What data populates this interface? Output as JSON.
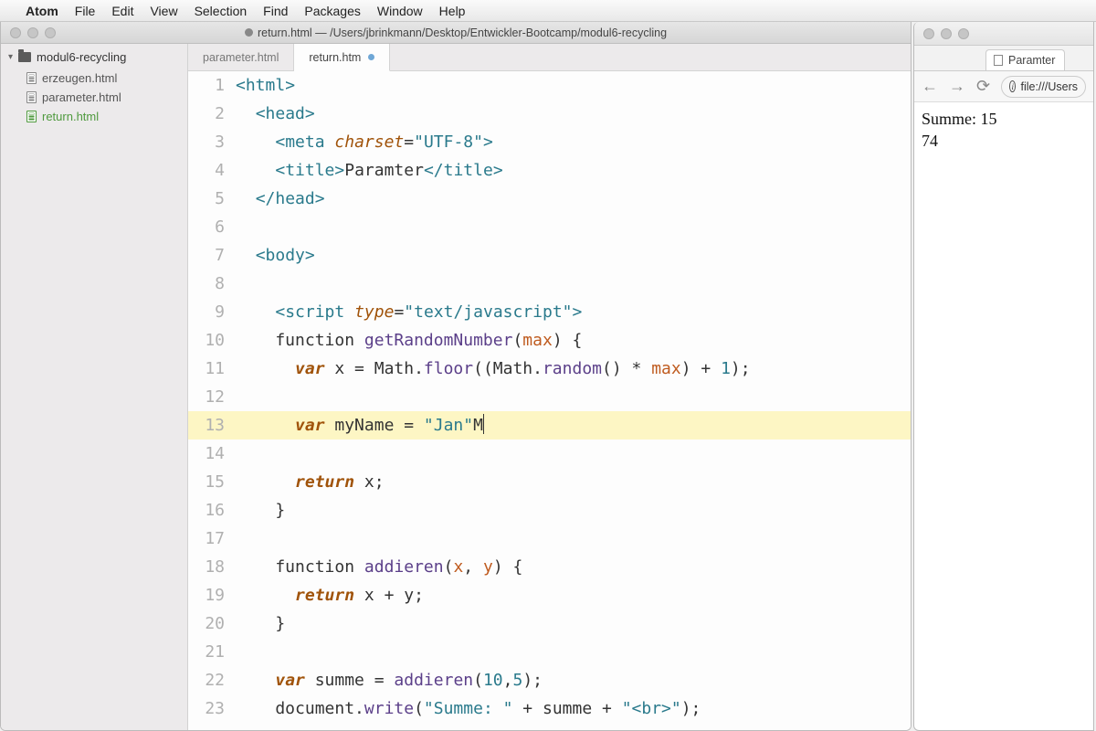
{
  "menubar": {
    "apple": "",
    "items": [
      "Atom",
      "File",
      "Edit",
      "View",
      "Selection",
      "Find",
      "Packages",
      "Window",
      "Help"
    ]
  },
  "window_title": "return.html — /Users/jbrinkmann/Desktop/Entwickler-Bootcamp/modul6-recycling",
  "sidebar": {
    "project": "modul6-recycling",
    "files": [
      {
        "name": "erzeugen.html",
        "active": false
      },
      {
        "name": "parameter.html",
        "active": false
      },
      {
        "name": "return.html",
        "active": true
      }
    ]
  },
  "tabs": [
    {
      "label": "parameter.html",
      "active": false,
      "modified": false
    },
    {
      "label": "return.htm",
      "active": true,
      "modified": true
    }
  ],
  "code_lines": [
    {
      "n": 1,
      "hl": false,
      "seg": [
        {
          "t": "<",
          "c": "p-tag"
        },
        {
          "t": "html",
          "c": "p-tag"
        },
        {
          "t": ">",
          "c": "p-tag"
        }
      ],
      "ind": 0
    },
    {
      "n": 2,
      "hl": false,
      "seg": [
        {
          "t": "<",
          "c": "p-tag"
        },
        {
          "t": "head",
          "c": "p-tag"
        },
        {
          "t": ">",
          "c": "p-tag"
        }
      ],
      "ind": 1
    },
    {
      "n": 3,
      "hl": false,
      "seg": [
        {
          "t": "<",
          "c": "p-tag"
        },
        {
          "t": "meta",
          "c": "p-tag"
        },
        {
          "t": " ",
          "c": ""
        },
        {
          "t": "charset",
          "c": "p-attr"
        },
        {
          "t": "=",
          "c": ""
        },
        {
          "t": "\"UTF-8\"",
          "c": "p-str"
        },
        {
          "t": ">",
          "c": "p-tag"
        }
      ],
      "ind": 2
    },
    {
      "n": 4,
      "hl": false,
      "seg": [
        {
          "t": "<",
          "c": "p-tag"
        },
        {
          "t": "title",
          "c": "p-tag"
        },
        {
          "t": ">",
          "c": "p-tag"
        },
        {
          "t": "Paramter",
          "c": ""
        },
        {
          "t": "</",
          "c": "p-tag"
        },
        {
          "t": "title",
          "c": "p-tag"
        },
        {
          "t": ">",
          "c": "p-tag"
        }
      ],
      "ind": 2
    },
    {
      "n": 5,
      "hl": false,
      "seg": [
        {
          "t": "</",
          "c": "p-tag"
        },
        {
          "t": "head",
          "c": "p-tag"
        },
        {
          "t": ">",
          "c": "p-tag"
        }
      ],
      "ind": 1
    },
    {
      "n": 6,
      "hl": false,
      "seg": [],
      "ind": 0
    },
    {
      "n": 7,
      "hl": false,
      "seg": [
        {
          "t": "<",
          "c": "p-tag"
        },
        {
          "t": "body",
          "c": "p-tag"
        },
        {
          "t": ">",
          "c": "p-tag"
        }
      ],
      "ind": 1
    },
    {
      "n": 8,
      "hl": false,
      "seg": [],
      "ind": 0
    },
    {
      "n": 9,
      "hl": false,
      "seg": [
        {
          "t": "<",
          "c": "p-tag"
        },
        {
          "t": "script",
          "c": "p-tag"
        },
        {
          "t": " ",
          "c": ""
        },
        {
          "t": "type",
          "c": "p-attr"
        },
        {
          "t": "=",
          "c": ""
        },
        {
          "t": "\"text/javascript\"",
          "c": "p-str"
        },
        {
          "t": ">",
          "c": "p-tag"
        }
      ],
      "ind": 2
    },
    {
      "n": 10,
      "hl": false,
      "seg": [
        {
          "t": "function",
          "c": ""
        },
        {
          "t": " ",
          "c": ""
        },
        {
          "t": "getRandomNumber",
          "c": "p-fn"
        },
        {
          "t": "(",
          "c": ""
        },
        {
          "t": "max",
          "c": "p-param"
        },
        {
          "t": ") {",
          "c": ""
        }
      ],
      "ind": 2
    },
    {
      "n": 11,
      "hl": false,
      "seg": [
        {
          "t": "var",
          "c": "p-kw"
        },
        {
          "t": " x = Math.",
          "c": ""
        },
        {
          "t": "floor",
          "c": "p-fn"
        },
        {
          "t": "((Math.",
          "c": ""
        },
        {
          "t": "random",
          "c": "p-fn"
        },
        {
          "t": "() * ",
          "c": ""
        },
        {
          "t": "max",
          "c": "p-param"
        },
        {
          "t": ") + ",
          "c": ""
        },
        {
          "t": "1",
          "c": "p-num"
        },
        {
          "t": ");",
          "c": ""
        }
      ],
      "ind": 3
    },
    {
      "n": 12,
      "hl": false,
      "seg": [],
      "ind": 0
    },
    {
      "n": 13,
      "hl": true,
      "seg": [
        {
          "t": "var",
          "c": "p-kw"
        },
        {
          "t": " myName = ",
          "c": ""
        },
        {
          "t": "\"Jan\"",
          "c": "p-str"
        },
        {
          "t": "M",
          "c": ""
        },
        {
          "t": "",
          "c": "cursor"
        }
      ],
      "ind": 3
    },
    {
      "n": 14,
      "hl": false,
      "seg": [],
      "ind": 0
    },
    {
      "n": 15,
      "hl": false,
      "seg": [
        {
          "t": "return",
          "c": "p-kw"
        },
        {
          "t": " x;",
          "c": ""
        }
      ],
      "ind": 3
    },
    {
      "n": 16,
      "hl": false,
      "seg": [
        {
          "t": "}",
          "c": ""
        }
      ],
      "ind": 2
    },
    {
      "n": 17,
      "hl": false,
      "seg": [],
      "ind": 0
    },
    {
      "n": 18,
      "hl": false,
      "seg": [
        {
          "t": "function",
          "c": ""
        },
        {
          "t": " ",
          "c": ""
        },
        {
          "t": "addieren",
          "c": "p-fn"
        },
        {
          "t": "(",
          "c": ""
        },
        {
          "t": "x",
          "c": "p-param"
        },
        {
          "t": ", ",
          "c": ""
        },
        {
          "t": "y",
          "c": "p-param"
        },
        {
          "t": ") {",
          "c": ""
        }
      ],
      "ind": 2
    },
    {
      "n": 19,
      "hl": false,
      "seg": [
        {
          "t": "return",
          "c": "p-kw"
        },
        {
          "t": " x + y;",
          "c": ""
        }
      ],
      "ind": 3
    },
    {
      "n": 20,
      "hl": false,
      "seg": [
        {
          "t": "}",
          "c": ""
        }
      ],
      "ind": 2
    },
    {
      "n": 21,
      "hl": false,
      "seg": [],
      "ind": 0
    },
    {
      "n": 22,
      "hl": false,
      "seg": [
        {
          "t": "var",
          "c": "p-kw"
        },
        {
          "t": " summe = ",
          "c": ""
        },
        {
          "t": "addieren",
          "c": "p-fn"
        },
        {
          "t": "(",
          "c": ""
        },
        {
          "t": "10",
          "c": "p-num"
        },
        {
          "t": ",",
          "c": ""
        },
        {
          "t": "5",
          "c": "p-num"
        },
        {
          "t": ");",
          "c": ""
        }
      ],
      "ind": 2
    },
    {
      "n": 23,
      "hl": false,
      "seg": [
        {
          "t": "document.",
          "c": ""
        },
        {
          "t": "write",
          "c": "p-fn"
        },
        {
          "t": "(",
          "c": ""
        },
        {
          "t": "\"Summe: \"",
          "c": "p-str"
        },
        {
          "t": " + summe + ",
          "c": ""
        },
        {
          "t": "\"<br>\"",
          "c": "p-str"
        },
        {
          "t": ");",
          "c": ""
        }
      ],
      "ind": 2
    }
  ],
  "browser": {
    "tab_title": "Paramter",
    "url": "file:///Users",
    "output": [
      "Summe: 15",
      "74"
    ]
  }
}
